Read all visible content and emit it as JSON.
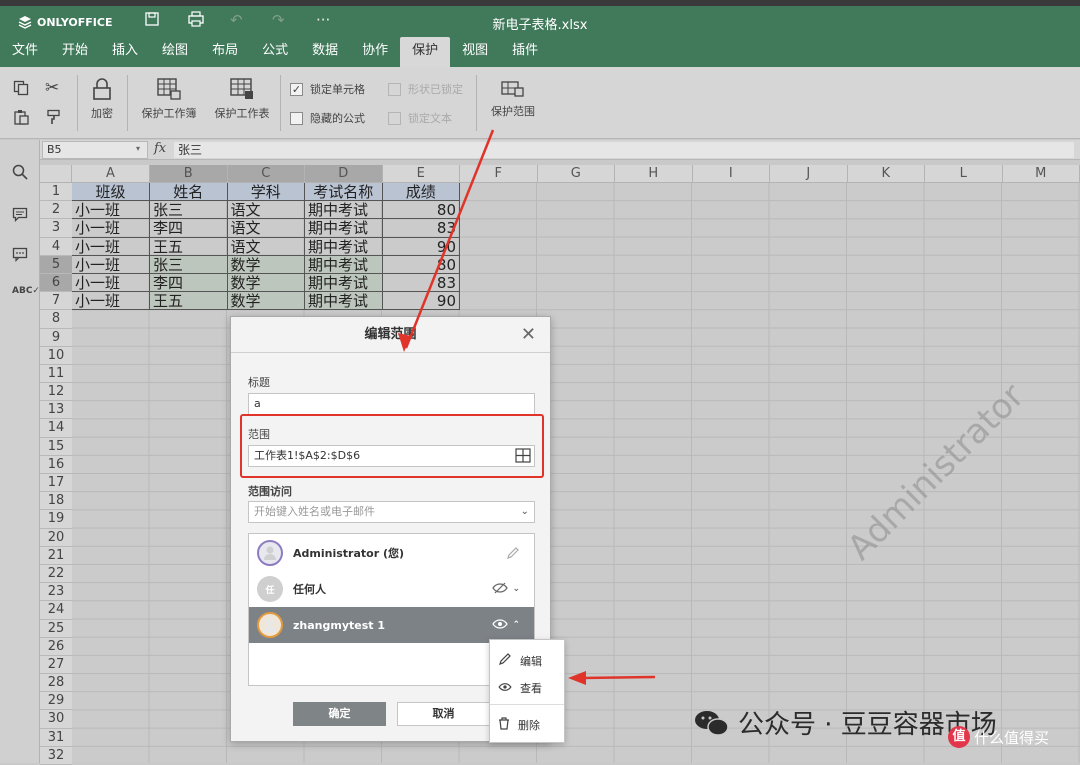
{
  "app": {
    "brand": "ONLYOFFICE",
    "file_title": "新电子表格.xlsx"
  },
  "menu_tabs": [
    "文件",
    "开始",
    "插入",
    "绘图",
    "布局",
    "公式",
    "数据",
    "协作",
    "保护",
    "视图",
    "插件"
  ],
  "ribbon": {
    "encrypt": "加密",
    "protect_workbook": "保护工作簿",
    "protect_sheet": "保护工作表",
    "lock_cells": "锁定单元格",
    "hidden_formula": "隐藏的公式",
    "shape_locked": "形状已锁定",
    "lock_text": "锁定文本",
    "protect_range": "保护范围"
  },
  "formula_bar": {
    "cell_ref": "B5",
    "fx": "fx",
    "value": "张三"
  },
  "columns": [
    "A",
    "B",
    "C",
    "D",
    "E",
    "F",
    "G",
    "H",
    "I",
    "J",
    "K",
    "L",
    "M"
  ],
  "rows": [
    "1",
    "2",
    "3",
    "4",
    "5",
    "6",
    "7",
    "8",
    "9",
    "10",
    "11",
    "12",
    "13",
    "14",
    "15",
    "16",
    "17",
    "18",
    "19",
    "20",
    "21",
    "22",
    "23",
    "24",
    "25",
    "26",
    "27",
    "28",
    "29",
    "30",
    "31",
    "32"
  ],
  "table": [
    [
      "班级",
      "姓名",
      "学科",
      "考试名称",
      "成绩"
    ],
    [
      "小一班",
      "张三",
      "语文",
      "期中考试",
      "80"
    ],
    [
      "小一班",
      "李四",
      "语文",
      "期中考试",
      "83"
    ],
    [
      "小一班",
      "王五",
      "语文",
      "期中考试",
      "90"
    ],
    [
      "小一班",
      "张三",
      "数学",
      "期中考试",
      "80"
    ],
    [
      "小一班",
      "李四",
      "数学",
      "期中考试",
      "83"
    ],
    [
      "小一班",
      "王五",
      "数学",
      "期中考试",
      "90"
    ]
  ],
  "dialog": {
    "title": "编辑范围",
    "title_label": "标题",
    "title_value": "a",
    "range_label": "范围",
    "range_value": "工作表1!$A$2:$D$6",
    "access_label": "范围访问",
    "access_placeholder": "开始键入姓名或电子邮件",
    "ok": "确定",
    "cancel": "取消",
    "users": [
      {
        "name": "Administrator (您)"
      },
      {
        "name": "任何人",
        "avatar": "任"
      },
      {
        "name": "zhangmytest 1"
      }
    ]
  },
  "context_menu": {
    "edit": "编辑",
    "view": "查看",
    "delete": "删除"
  },
  "watermark": {
    "diagonal": "Administrator",
    "wechat": "公众号 · 豆豆容器市场",
    "site": "什么值得买"
  },
  "colors": {
    "header_green": "#41795b",
    "arrow_red": "#e0342b"
  }
}
